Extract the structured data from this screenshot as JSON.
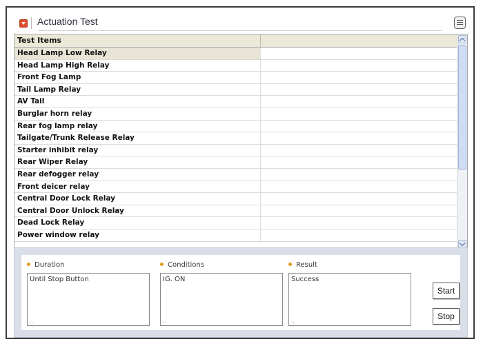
{
  "header": {
    "title": "Actuation Test",
    "accent_color": "#e04b2e"
  },
  "table": {
    "columns": [
      "Test Items",
      ""
    ],
    "selected_index": 0,
    "rows": [
      "Head Lamp Low Relay",
      "Head Lamp High Relay",
      "Front Fog Lamp",
      "Tail Lamp Relay",
      "AV Tail",
      "Burglar horn relay",
      "Rear fog lamp relay",
      "Tailgate/Trunk Release Relay",
      "Starter inhibit relay",
      "Rear Wiper Relay",
      "Rear defogger relay",
      "Front deicer relay",
      "Central Door Lock Relay",
      "Central Door Unlock Relay",
      "Dead Lock Relay",
      "Power window relay"
    ]
  },
  "panel": {
    "duration": {
      "label": "Duration",
      "value": "Until Stop Button"
    },
    "conditions": {
      "label": "Conditions",
      "value": "IG. ON"
    },
    "result": {
      "label": "Result",
      "value": "Success"
    },
    "start_label": "Start",
    "stop_label": "Stop",
    "bullet_color": "#e39a1e"
  }
}
